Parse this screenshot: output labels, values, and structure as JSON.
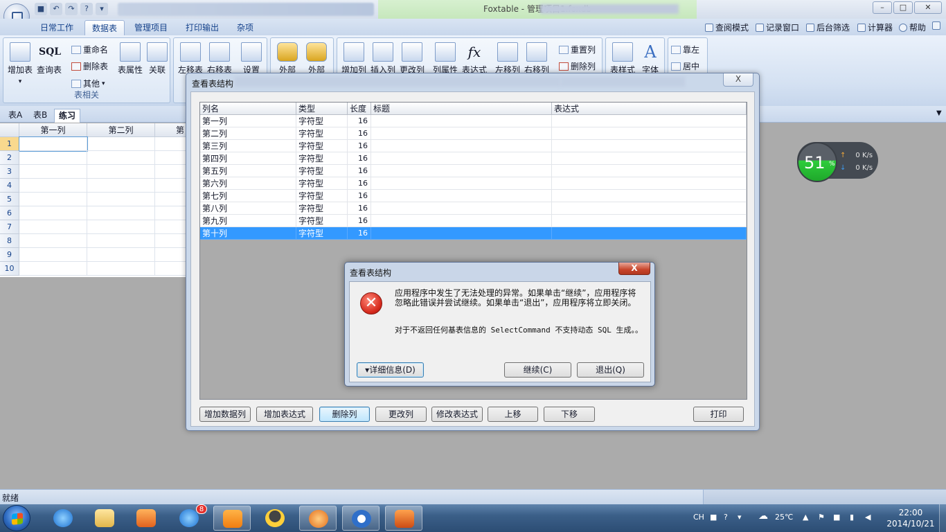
{
  "window": {
    "title": "Foxtable - 管理项目1.foxdb",
    "controls": [
      "minimize",
      "maximize",
      "close"
    ]
  },
  "ribbon": {
    "tabs": [
      "日常工作",
      "数据表",
      "管理项目",
      "打印输出",
      "杂项"
    ],
    "active_tab": "数据表",
    "right_links": [
      "查阅模式",
      "记录窗口",
      "后台筛选",
      "计算器",
      "帮助"
    ],
    "buttons": {
      "add_table": "增加表",
      "query_table": "查询表",
      "sql_icon_text": "SQL",
      "rename": "重命名",
      "delete_table": "删除表",
      "other": "其他",
      "table_props": "表属性",
      "relation": "关联",
      "move_table_left": "左移表",
      "move_table_right": "右移表",
      "settings": "设置",
      "external1": "外部",
      "external2": "外部",
      "add_column": "增加列",
      "insert_column": "插入列",
      "edit_column": "更改列",
      "column_props": "列属性",
      "expression": "表达式",
      "expression_icon_text": "fx",
      "move_col_left": "左移列",
      "move_col_right": "右移列",
      "reset_column": "重置列",
      "delete_column": "删除列",
      "table_style": "表样式",
      "font": "字体",
      "align_left": "靠左",
      "align_center": "居中"
    },
    "group_label": "表相关"
  },
  "sheet_tabs": [
    "表A",
    "表B",
    "练习"
  ],
  "active_sheet": "练习",
  "grid": {
    "columns": [
      "第一列",
      "第二列",
      "第"
    ],
    "rows": [
      "1",
      "2",
      "3",
      "4",
      "5",
      "6",
      "7",
      "8",
      "9",
      "10"
    ],
    "selected_row": "1"
  },
  "structure_dialog": {
    "title": "查看表结构",
    "close_label": "X",
    "headers": [
      "列名",
      "类型",
      "长度",
      "标题",
      "表达式"
    ],
    "rows": [
      {
        "name": "第一列",
        "type": "字符型",
        "length": "16"
      },
      {
        "name": "第二列",
        "type": "字符型",
        "length": "16"
      },
      {
        "name": "第三列",
        "type": "字符型",
        "length": "16"
      },
      {
        "name": "第四列",
        "type": "字符型",
        "length": "16"
      },
      {
        "name": "第五列",
        "type": "字符型",
        "length": "16"
      },
      {
        "name": "第六列",
        "type": "字符型",
        "length": "16"
      },
      {
        "name": "第七列",
        "type": "字符型",
        "length": "16"
      },
      {
        "name": "第八列",
        "type": "字符型",
        "length": "16"
      },
      {
        "name": "第九列",
        "type": "字符型",
        "length": "16"
      },
      {
        "name": "第十列",
        "type": "字符型",
        "length": "16"
      }
    ],
    "selected_row": "第十列",
    "buttons": [
      "增加数据列",
      "增加表达式",
      "删除列",
      "更改列",
      "修改表达式",
      "上移",
      "下移",
      "打印"
    ]
  },
  "error_dialog": {
    "title": "查看表结构",
    "close_label": "X",
    "icon": "error-x-icon",
    "message": "应用程序中发生了无法处理的异常。如果单击“继续”，应用程序将忽略此错误并尝试继续。如果单击“退出”，应用程序将立即关闭。",
    "detail": "对于不返回任何基表信息的 SelectCommand 不支持动态 SQL 生成。。",
    "details_button": "▾详细信息(D)",
    "continue_button": "继续(C)",
    "quit_button": "退出(Q)"
  },
  "net_widget": {
    "percent": "51",
    "percent_sign": "%",
    "upload": "0",
    "download": "0",
    "unit": "K/s"
  },
  "status_bar": {
    "text": "就绪"
  },
  "taskbar": {
    "apps": [
      "ie-icon",
      "explorer-icon",
      "media-player-icon",
      "ie2-icon",
      "uc-browser-icon",
      "qq-icon",
      "app-icon",
      "search-icon",
      "foxtable-icon"
    ],
    "badge": "8",
    "tray": {
      "lang": "CH",
      "weather": "25℃"
    },
    "time": "22:00",
    "date": "2014/10/21"
  },
  "colors": {
    "selection": "#3399ff",
    "ribbon_text": "#15428b",
    "error_red": "#d62a1d",
    "speed_green": "#2fcd3c"
  }
}
